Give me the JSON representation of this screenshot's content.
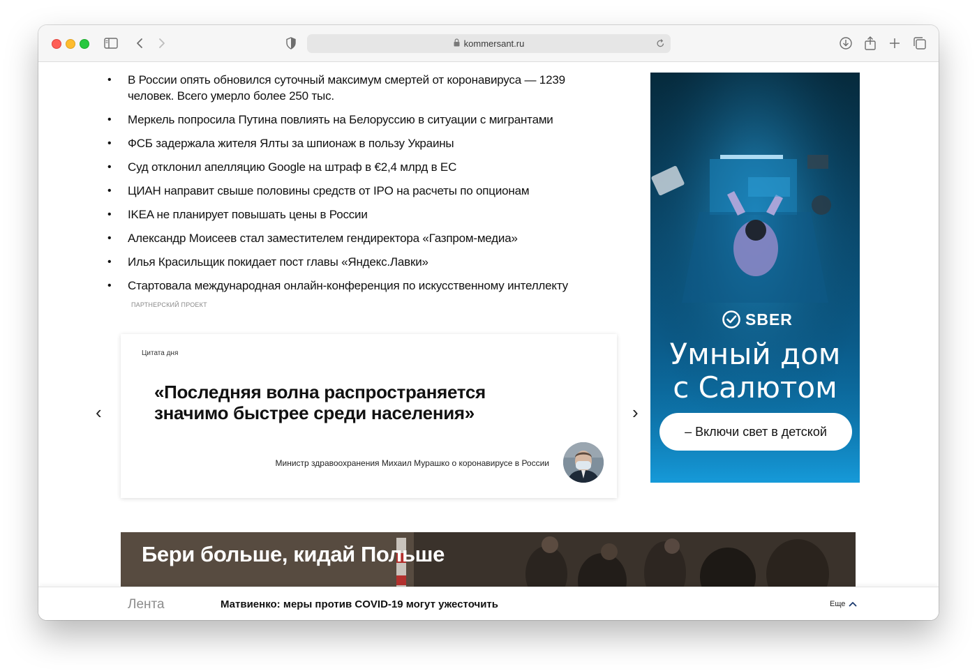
{
  "browser": {
    "url": "kommersant.ru"
  },
  "news": {
    "items": [
      "В России опять обновился суточный максимум смертей от коронавируса — 1239 человек. Всего умерло более 250 тыс.",
      "Меркель попросила Путина повлиять на Белоруссию в ситуации с мигрантами",
      "ФСБ задержала жителя Ялты за шпионаж в пользу Украины",
      "Суд отклонил апелляцию Google на штраф в €2,4 млрд в ЕС",
      "ЦИАН направит свыше половины средств от IPO на расчеты по опционам",
      "IKEA не планирует повышать цены в России",
      "Александр Моисеев стал заместителем гендиректора «Газпром-медиа»",
      "Илья Красильщик покидает пост главы «Яндекс.Лавки»",
      "Стартовала международная онлайн-конференция по искусственному интеллекту"
    ],
    "partner_label": "ПАРТНЕРСКИЙ ПРОЕКТ"
  },
  "quote": {
    "label": "Цитата дня",
    "text": "«Последняя волна распространяется значимо быстрее среди населения»",
    "author": "Министр здравоохранения Михаил Мурашко о коронавирусе в России",
    "prev": "‹",
    "next": "›"
  },
  "ad": {
    "brand": "SBER",
    "headline_line1": "Умный дом",
    "headline_line2": "с Салютом",
    "button": "– Включи свет в детской"
  },
  "banner": {
    "title": "Бери больше, кидай Польше"
  },
  "bottom": {
    "lenta": "Лента",
    "headline": "Матвиенко: меры против COVID-19 могут ужесточить",
    "more": "Еще"
  }
}
